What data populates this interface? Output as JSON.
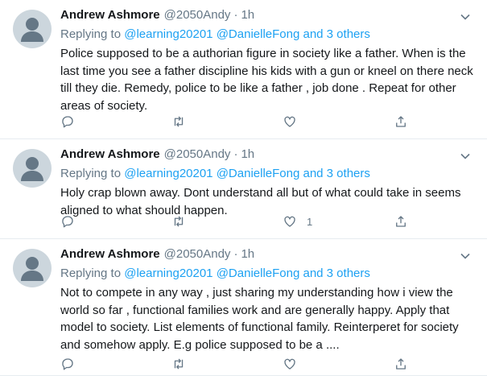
{
  "tweets": [
    {
      "name": "Andrew Ashmore",
      "handle": "@2050Andy",
      "dot": "·",
      "time": "1h",
      "replying_prefix": "Replying to",
      "replying_to": "@learning20201 @DanielleFong and 3 others",
      "text": "Police supposed to be a authorian figure in society like a father.  When is the last time you see a father discipline his kids with a gun or kneel on there neck till they die. Remedy,  police to be like a father , job done . Repeat for other areas of society.",
      "reply_count": "",
      "retweet_count": "",
      "like_count": ""
    },
    {
      "name": "Andrew Ashmore",
      "handle": "@2050Andy",
      "dot": "·",
      "time": "1h",
      "replying_prefix": "Replying to",
      "replying_to": "@learning20201 @DanielleFong and 3 others",
      "text": "Holy crap blown away. Dont understand all but of what could take in seems aligned to what should happen.",
      "reply_count": "",
      "retweet_count": "",
      "like_count": "1"
    },
    {
      "name": "Andrew Ashmore",
      "handle": "@2050Andy",
      "dot": "·",
      "time": "1h",
      "replying_prefix": "Replying to",
      "replying_to": "@learning20201 @DanielleFong and 3 others",
      "text": "Not to compete in any way , just sharing my understanding how i view the world so far , functional families work and are generally happy. Apply that model to society. List elements of functional family. Reinterperet for society and somehow apply. E.g police supposed to be a ....",
      "reply_count": "",
      "retweet_count": "",
      "like_count": ""
    }
  ],
  "icons": {
    "reply": "reply-icon",
    "retweet": "retweet-icon",
    "like": "heart-icon",
    "share": "share-icon",
    "more": "chevron-down-icon"
  },
  "colors": {
    "link": "#1da1f2",
    "secondary_text": "#657786",
    "border": "#e6ecf0",
    "avatar_bg": "#ccd6dd"
  }
}
